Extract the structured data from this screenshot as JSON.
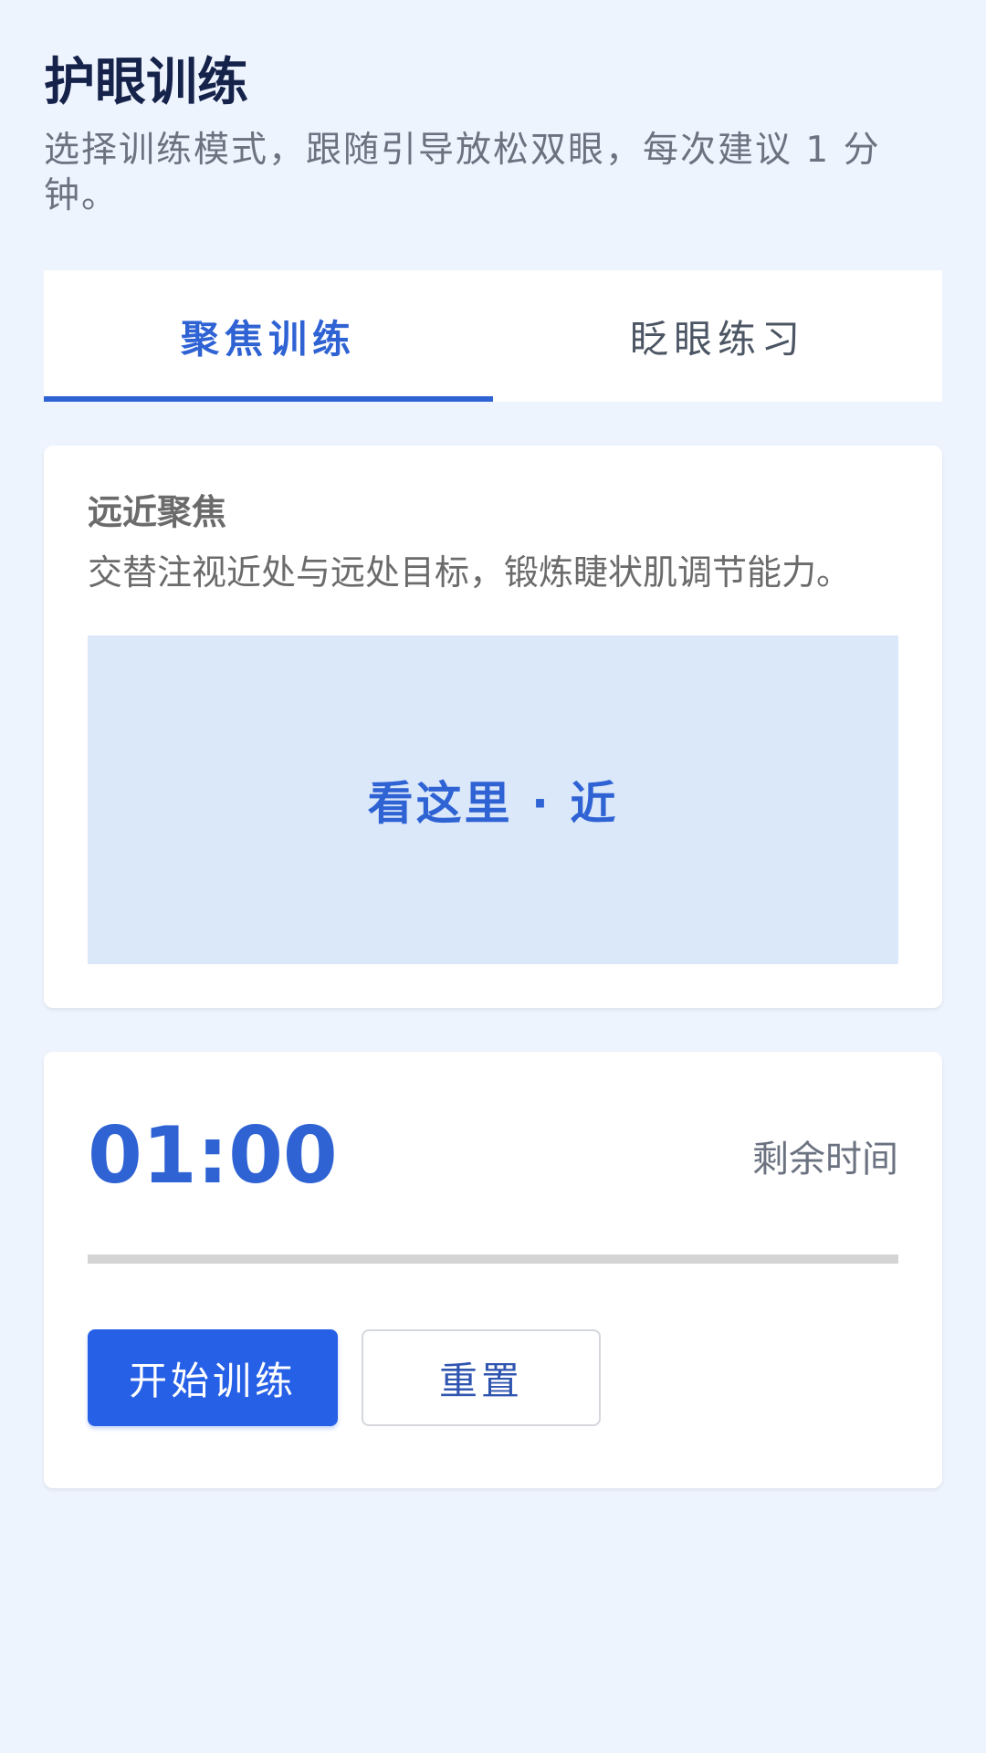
{
  "header": {
    "title": "护眼训练",
    "subtitle": "选择训练模式，跟随引导放松双眼，每次建议 1 分钟。"
  },
  "tabs": [
    {
      "label": "聚焦训练",
      "active": true
    },
    {
      "label": "眨眼练习",
      "active": false
    }
  ],
  "exercise": {
    "name": "远近聚焦",
    "description": "交替注视近处与远处目标，锻炼睫状肌调节能力。",
    "target_text": "看这里 · 近"
  },
  "timer": {
    "value": "01:00",
    "caption": "剩余时间",
    "progress_fraction": 0
  },
  "actions": {
    "start_label": "开始训练",
    "reset_label": "重置"
  },
  "colors": {
    "accent": "#2F63D4",
    "primary_button": "#2660E6",
    "background": "#EEF4FE",
    "target_area": "#DBE8FA"
  }
}
